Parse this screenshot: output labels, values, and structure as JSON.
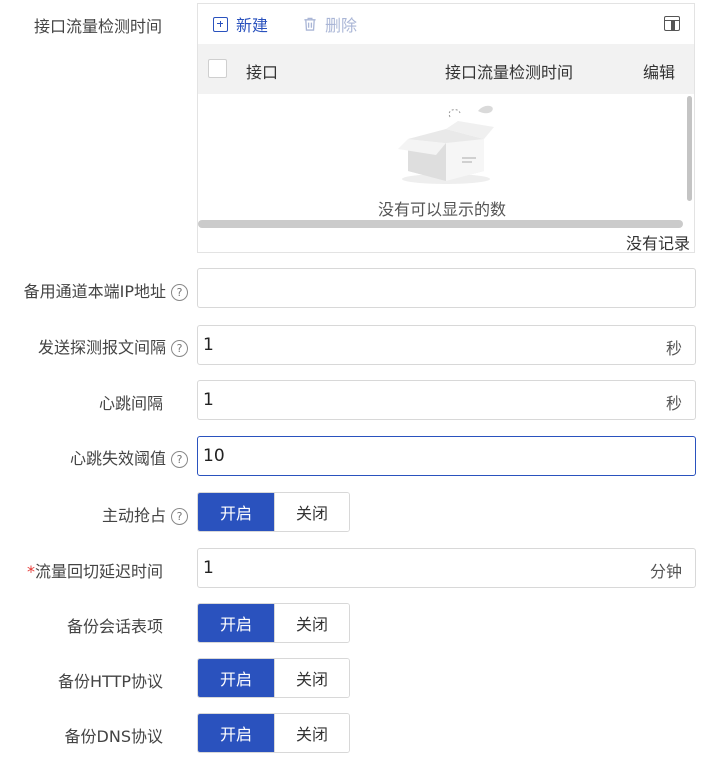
{
  "interface_monitor": {
    "label": "接口流量检测时间",
    "toolbar": {
      "new_label": "新建",
      "delete_label": "删除",
      "new_icon": "plus-square-icon",
      "delete_icon": "trash-icon",
      "columns_icon": "column-settings-icon"
    },
    "columns": [
      "接口",
      "接口流量检测时间",
      "编辑"
    ],
    "empty_text": "没有可以显示的数",
    "footer_text": "没有记录"
  },
  "fields": {
    "backup_ip": {
      "label": "备用通道本端IP地址",
      "value": ""
    },
    "probe_interval": {
      "label": "发送探测报文间隔",
      "value": "1",
      "unit": "秒"
    },
    "heartbeat_interval": {
      "label": "心跳间隔",
      "value": "1",
      "unit": "秒"
    },
    "heartbeat_threshold": {
      "label": "心跳失效阈值",
      "value": "10"
    },
    "preempt": {
      "label": "主动抢占",
      "on": "开启",
      "off": "关闭",
      "selected": "开启"
    },
    "switchback_delay": {
      "required_mark": "*",
      "label": "流量回切延迟时间",
      "value": "1",
      "unit": "分钟"
    },
    "backup_session": {
      "label": "备份会话表项",
      "on": "开启",
      "off": "关闭",
      "selected": "开启"
    },
    "backup_http": {
      "label": "备份HTTP协议",
      "on": "开启",
      "off": "关闭",
      "selected": "开启"
    },
    "backup_dns": {
      "label": "备份DNS协议",
      "on": "开启",
      "off": "关闭",
      "selected": "开启"
    }
  },
  "colors": {
    "accent": "#2a52be",
    "required": "#e53935",
    "header_bg": "#f2f2f2"
  }
}
